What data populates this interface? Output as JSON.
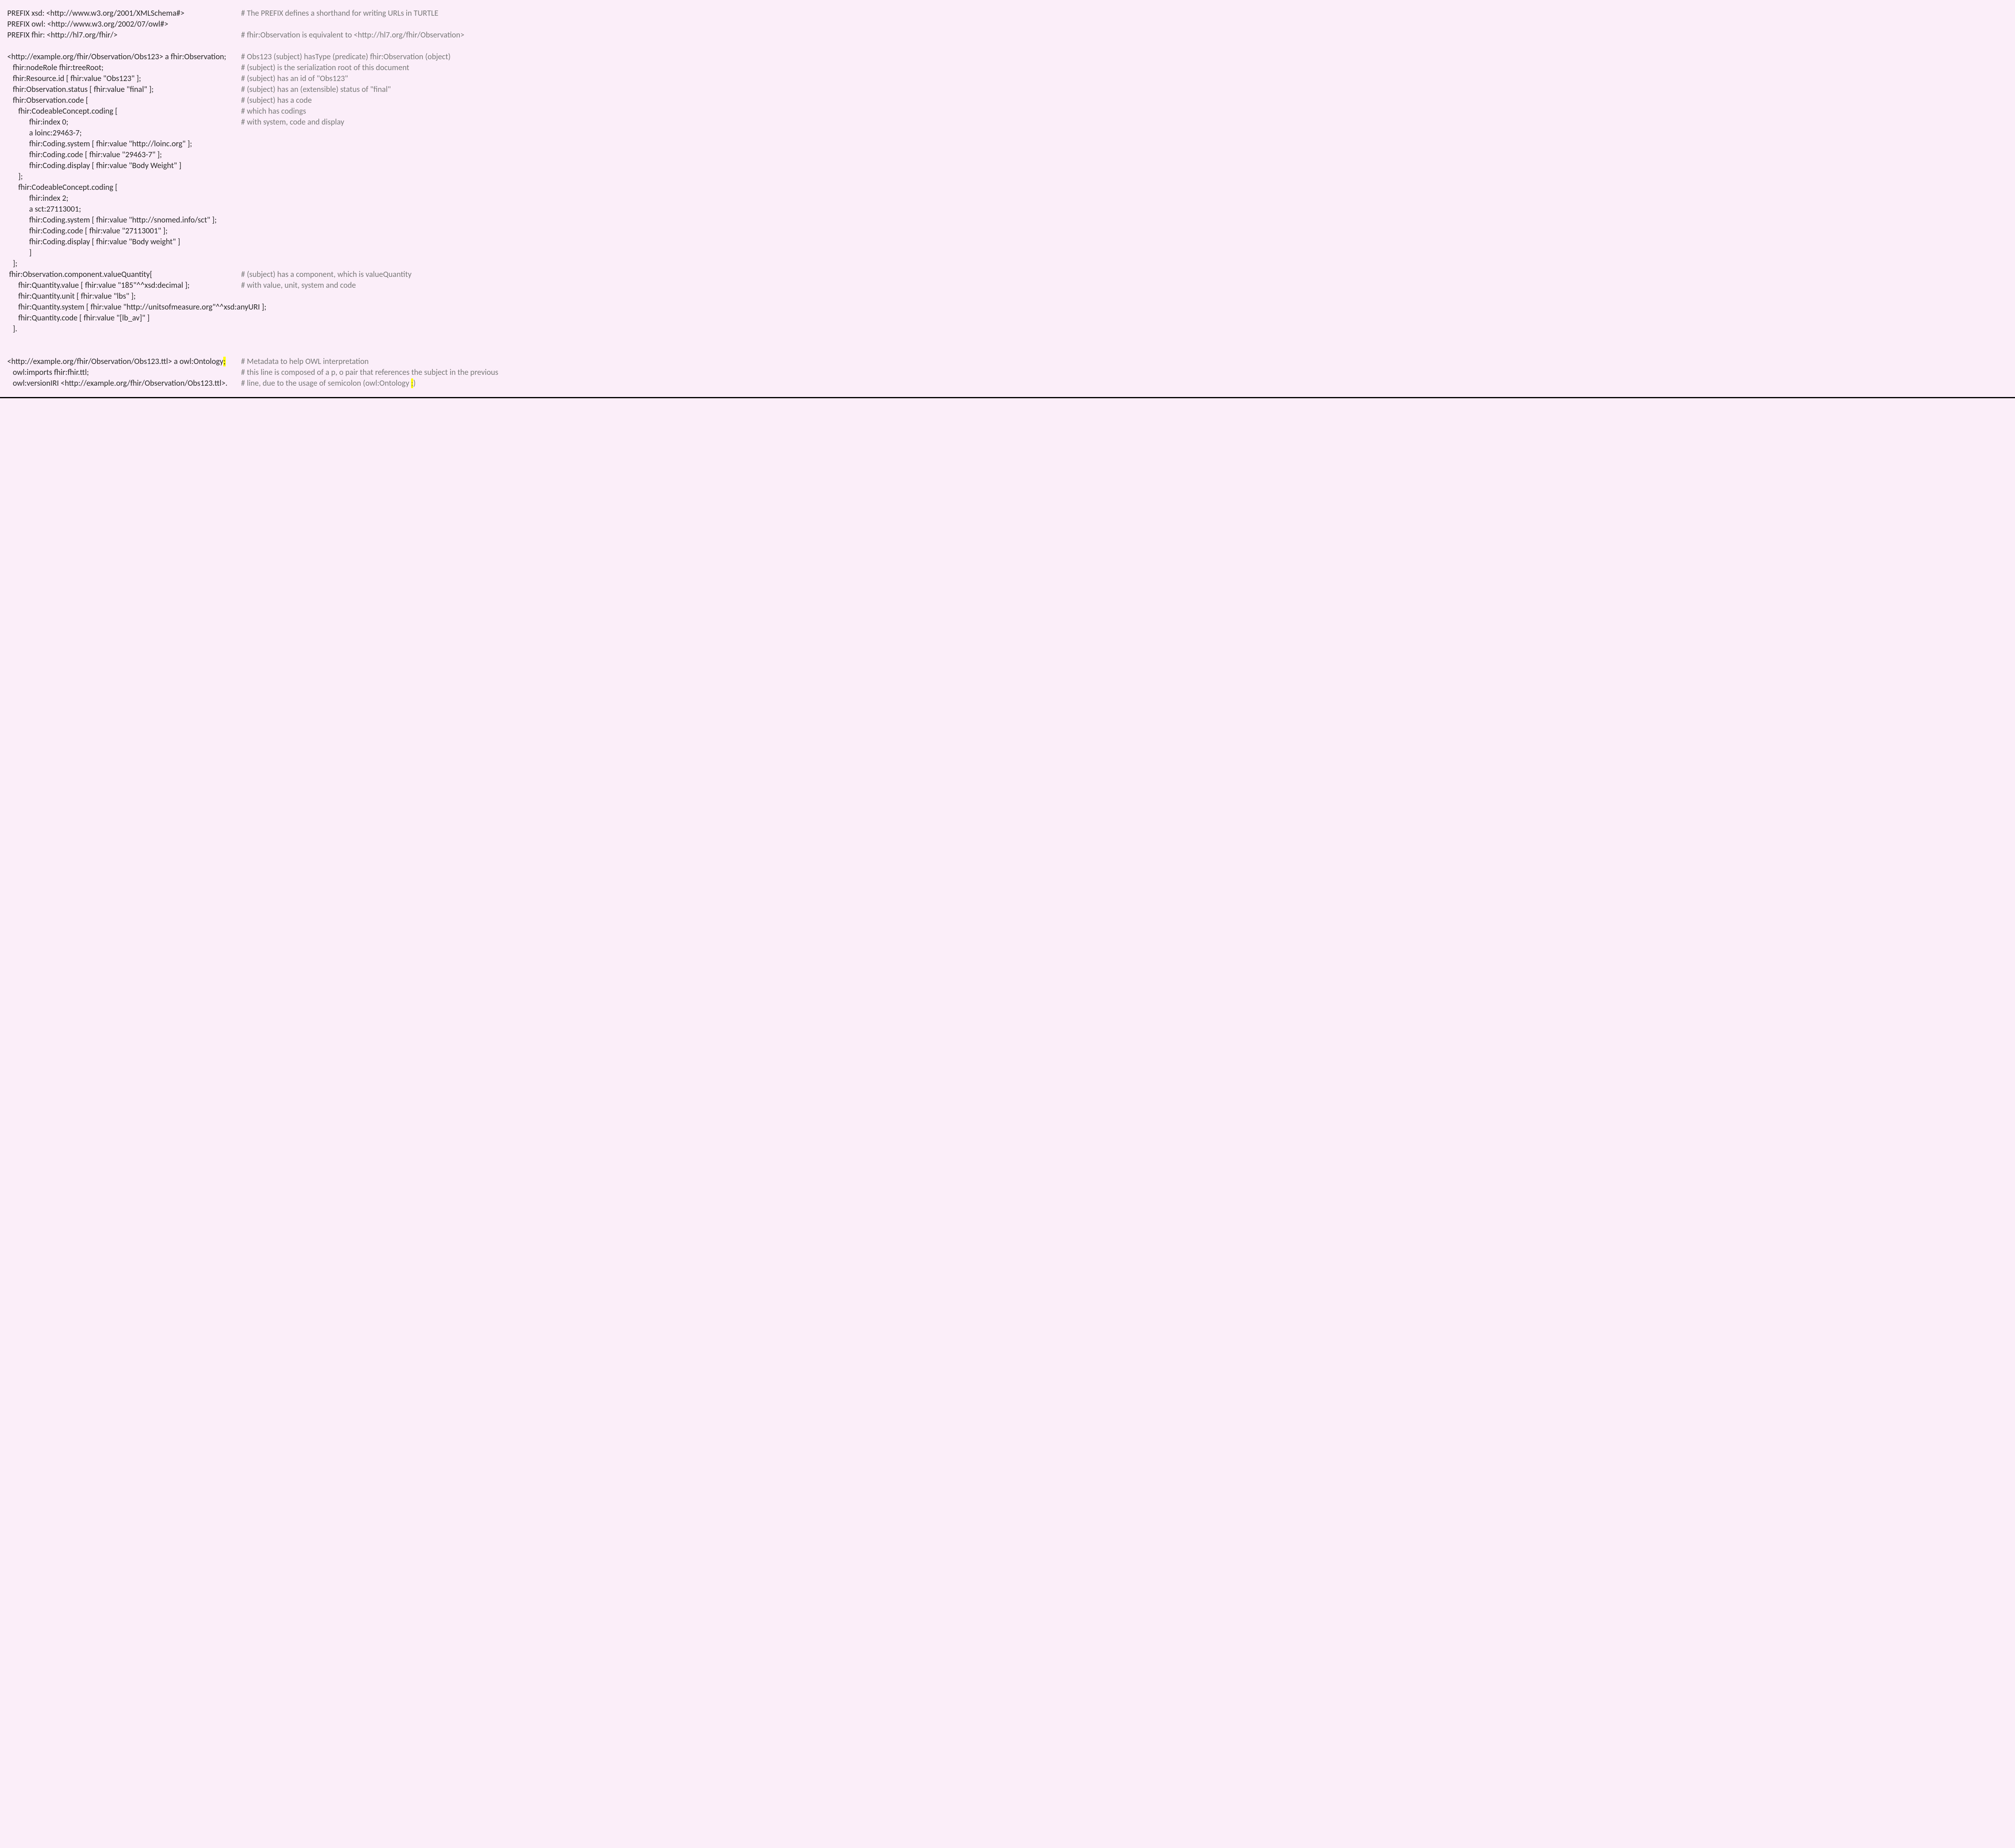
{
  "lines": [
    {
      "code": "PREFIX xsd: <http://www.w3.org/2001/XMLSchema#>",
      "comment": "# The PREFIX defines a shorthand for writing URLs in TURTLE"
    },
    {
      "code": "PREFIX owl: <http://www.w3.org/2002/07/owl#>",
      "comment": ""
    },
    {
      "code": "PREFIX fhir: <http://hl7.org/fhir/>",
      "comment": "# fhir:Observation is equivalent to <http://hl7.org/fhir/Observation>"
    },
    {
      "code": "",
      "comment": ""
    },
    {
      "code": "<http://example.org/fhir/Observation/Obs123> a fhir:Observation;",
      "comment": "# Obs123 (subject) hasType (predicate) fhir:Observation (object)"
    },
    {
      "code": "   fhir:nodeRole fhir:treeRoot;",
      "comment": "# (subject) is the serialization root of this document"
    },
    {
      "code": "   fhir:Resource.id [ fhir:value \"Obs123\" ];",
      "comment": "# (subject) has an id of \"Obs123\""
    },
    {
      "code": "   fhir:Observation.status [ fhir:value \"final\" ];",
      "comment": "# (subject) has an (extensible) status of \"final\""
    },
    {
      "code": "   fhir:Observation.code [",
      "comment": "# (subject) has a code"
    },
    {
      "code": "      fhir:CodeableConcept.coding [",
      "comment": "# which has codings"
    },
    {
      "code": "            fhir:index 0;",
      "comment": "# with system, code and display"
    },
    {
      "code": "            a loinc:29463-7;",
      "comment": ""
    },
    {
      "code": "            fhir:Coding.system [ fhir:value \"http://loinc.org\" ];",
      "comment": ""
    },
    {
      "code": "            fhir:Coding.code [ fhir:value \"29463-7\" ];",
      "comment": ""
    },
    {
      "code": "            fhir:Coding.display [ fhir:value \"Body Weight\" ]",
      "comment": ""
    },
    {
      "code": "      ];",
      "comment": ""
    },
    {
      "code": "      fhir:CodeableConcept.coding [",
      "comment": ""
    },
    {
      "code": "            fhir:index 2;",
      "comment": ""
    },
    {
      "code": "            a sct:27113001;",
      "comment": ""
    },
    {
      "code": "            fhir:Coding.system [ fhir:value \"http://snomed.info/sct\" ];",
      "comment": ""
    },
    {
      "code": "            fhir:Coding.code [ fhir:value \"27113001\" ];",
      "comment": ""
    },
    {
      "code": "            fhir:Coding.display [ fhir:value \"Body weight\" ]",
      "comment": ""
    },
    {
      "code": "            ]",
      "comment": ""
    },
    {
      "code": "   ];",
      "comment": ""
    },
    {
      "code": " fhir:Observation.component.valueQuantity[",
      "comment": "# (subject) has a component, which is valueQuantity"
    },
    {
      "code": "      fhir:Quantity.value [ fhir:value \"185\"^^xsd:decimal ];",
      "comment": "# with value, unit, system and code"
    },
    {
      "code": "      fhir:Quantity.unit [ fhir:value \"lbs\" ];",
      "comment": ""
    },
    {
      "code": "      fhir:Quantity.system [ fhir:value \"http://unitsofmeasure.org\"^^xsd:anyURI ];",
      "comment": ""
    },
    {
      "code": "      fhir:Quantity.code [ fhir:value \"[lb_av]\" ]",
      "comment": ""
    },
    {
      "code": "   ].",
      "comment": ""
    },
    {
      "code": "",
      "comment": ""
    },
    {
      "code": "",
      "comment": ""
    },
    {
      "code_parts": [
        "<http://example.org/fhir/Observation/Obs123.ttl> a owl:Ontology",
        ";"
      ],
      "code_hl_index": 1,
      "comment": "# Metadata to help OWL interpretation"
    },
    {
      "code": "   owl:imports fhir:fhir.ttl;",
      "comment": "# this line is composed of a p, o pair that references the subject in the previous"
    },
    {
      "code": "   owl:versionIRI <http://example.org/fhir/Observation/Obs123.ttl>.",
      "comment_parts": [
        "# line, due to the usage of semicolon (owl:Ontology ",
        ";",
        ")"
      ],
      "comment_hl_index": 1
    }
  ]
}
